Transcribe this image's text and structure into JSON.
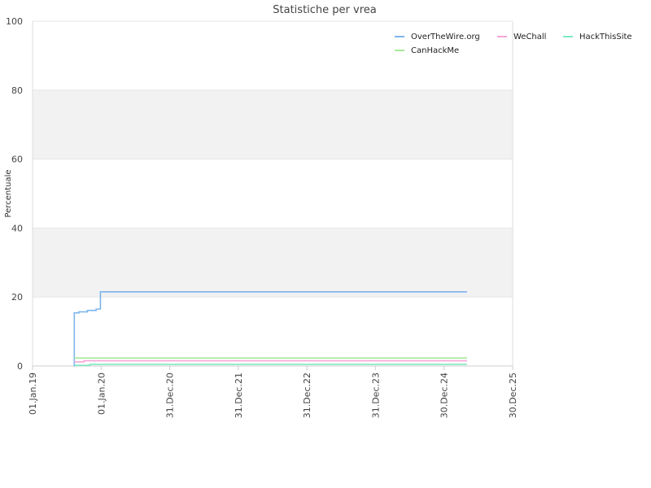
{
  "chart_data": {
    "type": "line",
    "title": "Statistiche per vrea",
    "xlabel": "",
    "ylabel": "Percentuale",
    "ylim": [
      0,
      100
    ],
    "xlim": [
      "2019-01-01",
      "2025-12-30"
    ],
    "y_ticks": [
      0,
      20,
      40,
      60,
      80,
      100
    ],
    "x_ticks": [
      {
        "date": "2019-01-01",
        "label": "01.Jan.19"
      },
      {
        "date": "2020-01-01",
        "label": "01.Jan.20"
      },
      {
        "date": "2020-12-31",
        "label": "31.Dec.20"
      },
      {
        "date": "2021-12-31",
        "label": "31.Dec.21"
      },
      {
        "date": "2022-12-31",
        "label": "31.Dec.22"
      },
      {
        "date": "2023-12-31",
        "label": "31.Dec.23"
      },
      {
        "date": "2024-12-30",
        "label": "30.Dec.24"
      },
      {
        "date": "2025-12-30",
        "label": "30.Dec.25"
      }
    ],
    "grid": true,
    "band_color": "#f2f2f2",
    "legend_position": "top-right",
    "series": [
      {
        "name": "OverTheWire.org",
        "color": "#7cb5ec",
        "step": true,
        "points": [
          {
            "x": "2019-08-10",
            "y": 0
          },
          {
            "x": "2019-08-11",
            "y": 15.4
          },
          {
            "x": "2019-09-05",
            "y": 15.7
          },
          {
            "x": "2019-10-20",
            "y": 16.1
          },
          {
            "x": "2019-12-05",
            "y": 16.5
          },
          {
            "x": "2019-12-28",
            "y": 21.5
          },
          {
            "x": "2025-05-01",
            "y": 21.5
          }
        ]
      },
      {
        "name": "WeChall",
        "color": "#f7a6d8",
        "step": true,
        "points": [
          {
            "x": "2019-08-11",
            "y": 1.2
          },
          {
            "x": "2019-10-01",
            "y": 1.5
          },
          {
            "x": "2025-05-01",
            "y": 1.5
          }
        ]
      },
      {
        "name": "HackThisSite",
        "color": "#7ee8c2",
        "step": true,
        "points": [
          {
            "x": "2019-08-11",
            "y": 0.2
          },
          {
            "x": "2019-11-01",
            "y": 0.5
          },
          {
            "x": "2025-05-01",
            "y": 0.5
          }
        ]
      },
      {
        "name": "CanHackMe",
        "color": "#a8e89a",
        "step": true,
        "points": [
          {
            "x": "2019-08-11",
            "y": 2.3
          },
          {
            "x": "2025-05-01",
            "y": 2.3
          }
        ]
      }
    ]
  }
}
